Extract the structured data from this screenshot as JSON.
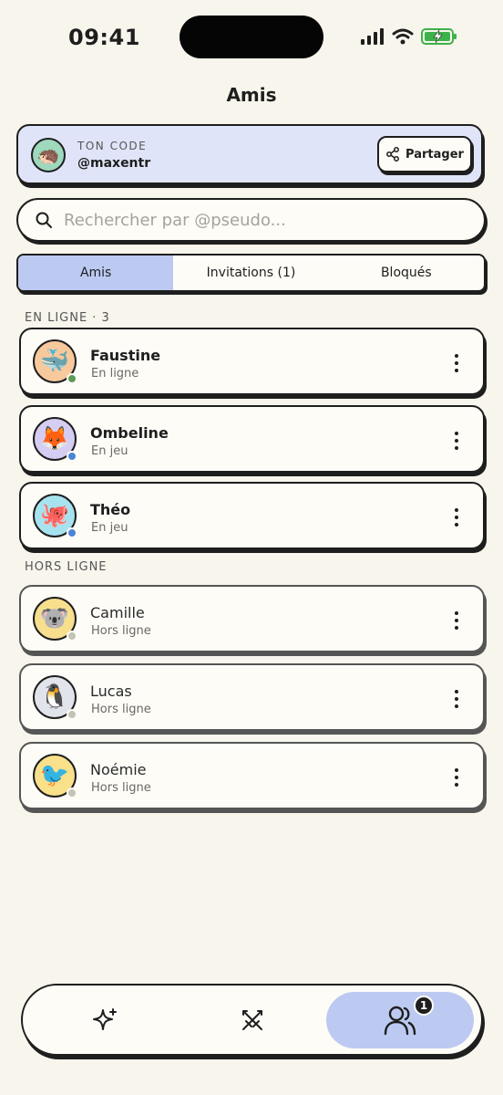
{
  "status_bar": {
    "time": "09:41"
  },
  "header": {
    "title": "Amis"
  },
  "code_card": {
    "label": "TON CODE",
    "value": "@maxentr",
    "share_label": "Partager",
    "avatar_emoji": "🦔"
  },
  "search": {
    "placeholder": "Rechercher par @pseudo...",
    "value": ""
  },
  "tabs": [
    {
      "label": "Amis",
      "active": true
    },
    {
      "label": "Invitations (1)",
      "active": false
    },
    {
      "label": "Bloqués",
      "active": false
    }
  ],
  "sections": {
    "online": {
      "label": "EN LIGNE · 3"
    },
    "offline": {
      "label": "HORS LIGNE"
    }
  },
  "friends_online": [
    {
      "name": "Faustine",
      "status": "En ligne",
      "emoji": "🐳",
      "avatar_color": "#f7c99c",
      "presence_color": "#5f9a55"
    },
    {
      "name": "Ombeline",
      "status": "En jeu",
      "emoji": "🦊",
      "avatar_color": "#d6cdf3",
      "presence_color": "#4a86d8"
    },
    {
      "name": "Théo",
      "status": "En jeu",
      "emoji": "🐙",
      "avatar_color": "#a7e3ef",
      "presence_color": "#4a86d8"
    }
  ],
  "friends_offline": [
    {
      "name": "Camille",
      "status": "Hors ligne",
      "emoji": "🐨",
      "avatar_color": "#f7df8e",
      "presence_color": "#c4c4b6"
    },
    {
      "name": "Lucas",
      "status": "Hors ligne",
      "emoji": "🐧",
      "avatar_color": "#e1e4ea",
      "presence_color": "#c4c4b6"
    },
    {
      "name": "Noémie",
      "status": "Hors ligne",
      "emoji": "🐦",
      "avatar_color": "#f9e08a",
      "presence_color": "#c4c4b6"
    }
  ],
  "bottom_nav": {
    "items": [
      {
        "icon": "sparkles-icon",
        "active": false
      },
      {
        "icon": "swords-icon",
        "active": false
      },
      {
        "icon": "friends-icon",
        "active": true,
        "badge": "1"
      }
    ]
  },
  "colors": {
    "background": "#f8f5ec",
    "accent": "#bccaf2",
    "card_tint": "#dfe4f8",
    "ink": "#1e1e1e"
  }
}
